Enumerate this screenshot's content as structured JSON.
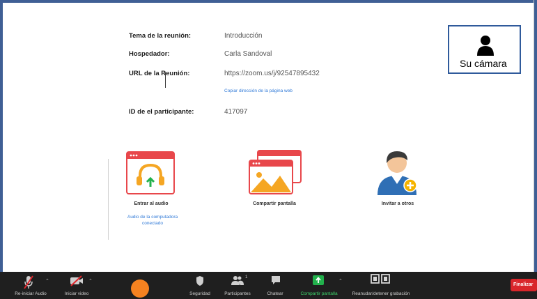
{
  "meeting": {
    "topic_label": "Tema de la reunión:",
    "topic_value": "Introducción",
    "host_label": "Hospedador:",
    "host_value": "Carla Sandoval",
    "url_label": "URL de la Reunión:",
    "url_value": "https://zoom.us/j/92547895432",
    "copy_link": "Copiar dirección de la página web",
    "participant_id_label": "ID de el participante:",
    "participant_id_value": "417097"
  },
  "camera": {
    "label": "Su cámara"
  },
  "actions": {
    "audio_label": "Entrar al audio",
    "audio_status": "Audio de la computadora conectado",
    "share_label": "Compartir pantalla",
    "invite_label": "Invitar a otros"
  },
  "toolbar": {
    "audio": "Re-iniciar Audio",
    "video": "Iniciar video",
    "security": "Seguridad",
    "participants": "Participantes",
    "participants_count": "1",
    "chat": "Chatear",
    "share": "Compartir pantalla",
    "record": "Reanudar/detener grabación",
    "end": "Finalizar"
  },
  "colors": {
    "frame": "#3f5f95",
    "toolbar": "#1f1f1f",
    "share_green": "#22b14c",
    "end_red": "#d9262b",
    "link_blue": "#2f79d7",
    "orange": "#f58220"
  },
  "icons": {
    "camera": "person-silhouette-icon",
    "audio": "headphones-icon",
    "share": "share-screen-icon",
    "invite": "add-person-icon",
    "mic": "mic-muted-icon",
    "video": "video-off-icon",
    "security": "shield-icon",
    "participants": "participants-icon",
    "chat": "chat-bubble-icon",
    "share_toolbar": "share-arrow-icon",
    "record": "record-icon"
  }
}
